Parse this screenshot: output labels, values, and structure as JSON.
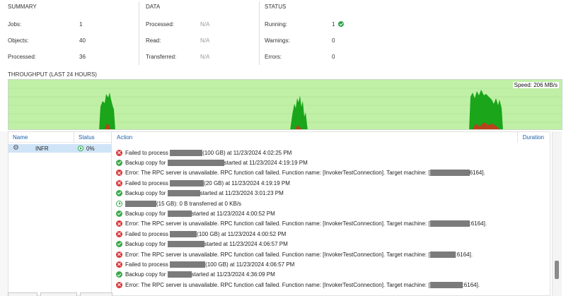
{
  "summary": {
    "title": "SUMMARY",
    "rows": [
      {
        "label": "Jobs:",
        "value": "1"
      },
      {
        "label": "Objects:",
        "value": "40"
      },
      {
        "label": "Processed:",
        "value": "36"
      }
    ]
  },
  "data_section": {
    "title": "DATA",
    "rows": [
      {
        "label": "Processed:",
        "value": "N/A"
      },
      {
        "label": "Read:",
        "value": "N/A"
      },
      {
        "label": "Transferred:",
        "value": "N/A"
      }
    ]
  },
  "status_section": {
    "title": "STATUS",
    "rows": [
      {
        "label": "Running:",
        "value": "1"
      },
      {
        "label": "Warnings:",
        "value": "0"
      },
      {
        "label": "Errors:",
        "value": "0"
      }
    ]
  },
  "throughput": {
    "title": "THROUGHPUT (LAST 24 HOURS)",
    "speed": "Speed: 206 MB/s",
    "colors": {
      "background": "#bff0a6",
      "read": "#1aa51a",
      "transfer": "#b8421c"
    }
  },
  "jobs_pane": {
    "col_name": "Name",
    "col_status": "Status",
    "job": {
      "name": "INFR",
      "status": "0%"
    }
  },
  "log_pane": {
    "col_action": "Action",
    "col_duration": "Duration",
    "lines": [
      {
        "type": "error",
        "pre": "Failed to process",
        "post": "(100 GB) at 11/23/2024 4:02:25 PM"
      },
      {
        "type": "ok",
        "pre": "Backup copy for",
        "post": "started at 11/23/2024 4:19:19 PM"
      },
      {
        "type": "error",
        "pre": "Error: The RPC server is unavailable. RPC function call failed. Function name: [InvokerTestConnection]. Target machine: [",
        "post": "6164]."
      },
      {
        "type": "error",
        "pre": "Failed to process",
        "post": "(20 GB) at 11/23/2024 4:19:19 PM"
      },
      {
        "type": "ok",
        "pre": "Backup copy for",
        "post": "started at 11/23/2024 3:01:23 PM"
      },
      {
        "type": "running",
        "pre": "",
        "post": "(15 GB): 0 B transferred at 0 KB/s"
      },
      {
        "type": "ok",
        "pre": "Backup copy for",
        "post": "started at 11/23/2024 4:00:52 PM"
      },
      {
        "type": "error",
        "pre": "Error: The RPC server is unavailable. RPC function call failed. Function name: [InvokerTestConnection]. Target machine: [",
        "post": ":6164]."
      },
      {
        "type": "error",
        "pre": "Failed to process",
        "post": "(100 GB) at 11/23/2024 4:00:52 PM"
      },
      {
        "type": "ok",
        "pre": "Backup copy for",
        "post": "started at 11/23/2024 4:06:57 PM"
      },
      {
        "type": "error",
        "pre": "Error: The RPC server is unavailable. RPC function call failed. Function name: [InvokerTestConnection]. Target machine: [",
        "post": ":6164]."
      },
      {
        "type": "error",
        "pre": "Failed to process",
        "post": "(100 GB) at 11/23/2024 4:06:57 PM"
      },
      {
        "type": "ok",
        "pre": "Backup copy for",
        "post": "started at 11/23/2024 4:36:09 PM"
      },
      {
        "type": "error",
        "pre": "Error: The RPC server is unavailable. RPC function call failed. Function name: [InvokerTestConnection]. Target machine: [",
        "post": ":6164]."
      }
    ]
  },
  "icons": {
    "gear": "gear-icon",
    "error": "error-icon",
    "success": "success-icon",
    "running": "running-icon"
  }
}
